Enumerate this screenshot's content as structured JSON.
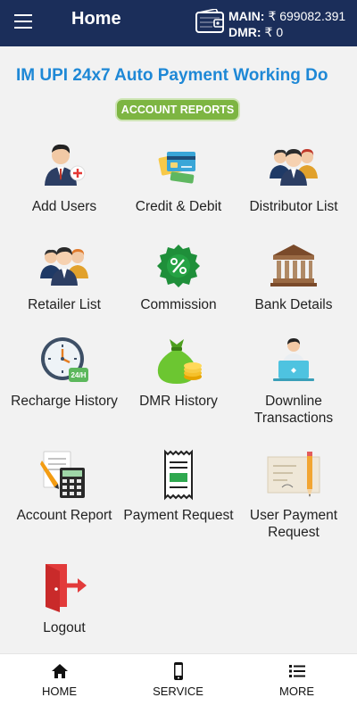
{
  "header": {
    "title": "Home",
    "balances": [
      {
        "label": "MAIN:",
        "value": "₹ 699082.391"
      },
      {
        "label": "DMR:",
        "value": "₹ 0"
      }
    ]
  },
  "ticker": {
    "text": "IM UPI 24x7 Auto Payment Working  Do"
  },
  "account_reports_button": "ACCOUNT REPORTS",
  "tiles": [
    {
      "label": "Add Users",
      "icon": "add-user-icon"
    },
    {
      "label": "Credit & Debit",
      "icon": "credit-card-icon"
    },
    {
      "label": "Distributor List",
      "icon": "group-icon"
    },
    {
      "label": "Retailer List",
      "icon": "group-icon"
    },
    {
      "label": "Commission",
      "icon": "percent-badge-icon"
    },
    {
      "label": "Bank Details",
      "icon": "bank-icon"
    },
    {
      "label": "Recharge History",
      "icon": "clock-24h-icon"
    },
    {
      "label": "DMR History",
      "icon": "money-bag-icon"
    },
    {
      "label": "Downline Transactions",
      "icon": "laptop-user-icon"
    },
    {
      "label": "Account Report",
      "icon": "calculator-report-icon"
    },
    {
      "label": "Payment Request",
      "icon": "receipt-icon"
    },
    {
      "label": "User Payment Request",
      "icon": "cheque-pencil-icon"
    },
    {
      "label": "Logout",
      "icon": "logout-door-icon"
    }
  ],
  "bottom_nav": [
    {
      "label": "HOME",
      "icon": "home-icon"
    },
    {
      "label": "SERVICE",
      "icon": "phone-icon"
    },
    {
      "label": "MORE",
      "icon": "list-icon"
    }
  ],
  "colors": {
    "appbar": "#1b2e5a",
    "accent_blue": "#1e88d6",
    "reports_button": "#7db542",
    "background": "#f2f2f2"
  }
}
